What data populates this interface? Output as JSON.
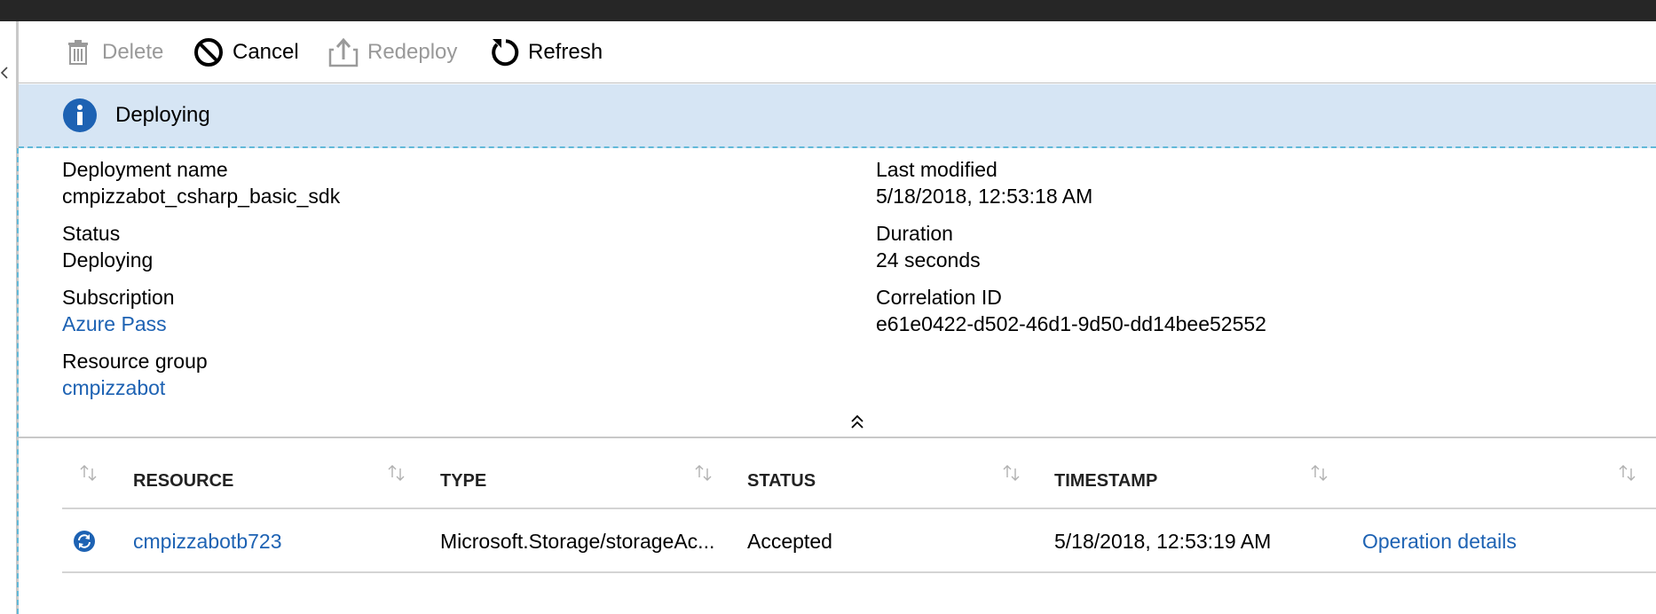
{
  "toolbar": {
    "delete_label": "Delete",
    "cancel_label": "Cancel",
    "redeploy_label": "Redeploy",
    "refresh_label": "Refresh"
  },
  "banner": {
    "status_text": "Deploying",
    "icon": "info-icon",
    "color": "#1d62b3"
  },
  "details": {
    "deployment_name": {
      "label": "Deployment name",
      "value": "cmpizzabot_csharp_basic_sdk"
    },
    "status": {
      "label": "Status",
      "value": "Deploying"
    },
    "subscription": {
      "label": "Subscription",
      "value": "Azure Pass"
    },
    "resource_group": {
      "label": "Resource group",
      "value": "cmpizzabot"
    },
    "last_modified": {
      "label": "Last modified",
      "value": "5/18/2018, 12:53:18 AM"
    },
    "duration": {
      "label": "Duration",
      "value": "24 seconds"
    },
    "correlation_id": {
      "label": "Correlation ID",
      "value": "e61e0422-d502-46d1-9d50-dd14bee52552"
    }
  },
  "table": {
    "headers": [
      "RESOURCE",
      "TYPE",
      "STATUS",
      "TIMESTAMP"
    ],
    "rows": [
      {
        "resource": "cmpizzabotb723",
        "type": "Microsoft.Storage/storageAc...",
        "status": "Accepted",
        "timestamp": "5/18/2018, 12:53:19 AM",
        "action": "Operation details"
      }
    ]
  },
  "colors": {
    "link": "#1d62b3",
    "banner_bg": "#d6e5f4",
    "dashed": "#62b9d8",
    "topbar": "#262626"
  }
}
